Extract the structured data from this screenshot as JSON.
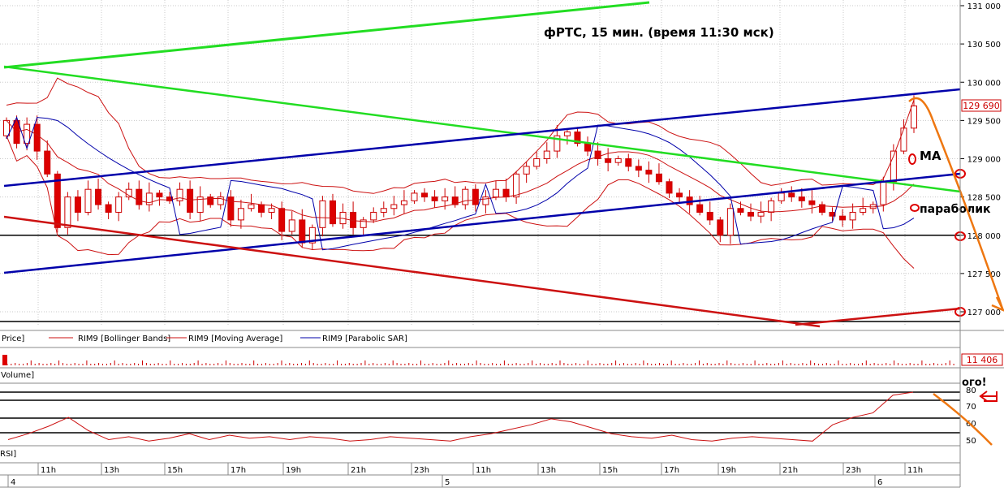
{
  "chart_data": {
    "type": "candlestick",
    "title": "фРТС,  15 мин. (время 11:30 мск)",
    "y_ticks": [
      "131 000",
      "130 500",
      "130 000",
      "129 500",
      "129 000",
      "128 500",
      "128 000",
      "127 500",
      "127 000"
    ],
    "ylim": [
      126900,
      131100
    ],
    "last_price": "129 690",
    "legend": {
      "price": "Price]",
      "bollinger": "RIM9 [Bollinger Bands]",
      "moving_average": "RIM9 [Moving Average]",
      "parabolic_sar": "RIM9 [Parabolic SAR]"
    },
    "volume": {
      "label": "Volume]",
      "last_value": "11 406"
    },
    "rsi": {
      "label": "RSI]",
      "ticks": [
        "80",
        "70",
        "60",
        "50"
      ]
    },
    "x_hours": [
      "11h",
      "13h",
      "15h",
      "17h",
      "19h",
      "21h",
      "23h",
      "11h",
      "13h",
      "15h",
      "17h",
      "19h",
      "21h",
      "23h",
      "11h"
    ],
    "x_days": [
      "4",
      "5",
      "6"
    ],
    "annotations": {
      "ma": "MA",
      "parabolic": "параболик",
      "ogo": "ого!"
    },
    "close_series": [
      129500,
      129200,
      129450,
      129100,
      128800,
      128100,
      128500,
      128300,
      128600,
      128400,
      128300,
      128500,
      128600,
      128400,
      128550,
      128500,
      128450,
      128600,
      128300,
      128500,
      128400,
      128500,
      128200,
      128350,
      128400,
      128300,
      128350,
      128050,
      128200,
      127900,
      128100,
      128450,
      128150,
      128300,
      128100,
      128200,
      128300,
      128350,
      128400,
      128450,
      128550,
      128500,
      128450,
      128500,
      128400,
      128600,
      128400,
      128500,
      128600,
      128500,
      128800,
      128900,
      129000,
      129100,
      129300,
      129350,
      129200,
      129100,
      129000,
      128950,
      129000,
      128900,
      128850,
      128800,
      128700,
      128550,
      128500,
      128400,
      128300,
      128200,
      128000,
      128350,
      128300,
      128250,
      128300,
      128450,
      128550,
      128500,
      128450,
      128400,
      128300,
      128250,
      128200,
      128300,
      128350,
      128400,
      128700,
      129100,
      129400,
      129690
    ],
    "colors": {
      "bull": "#cc2222",
      "bear": "#dd0000",
      "green_line": "#22dd22",
      "blue_line": "#0000aa",
      "red_line": "#cc1111",
      "orange": "#ee7711",
      "black": "#000000"
    }
  }
}
